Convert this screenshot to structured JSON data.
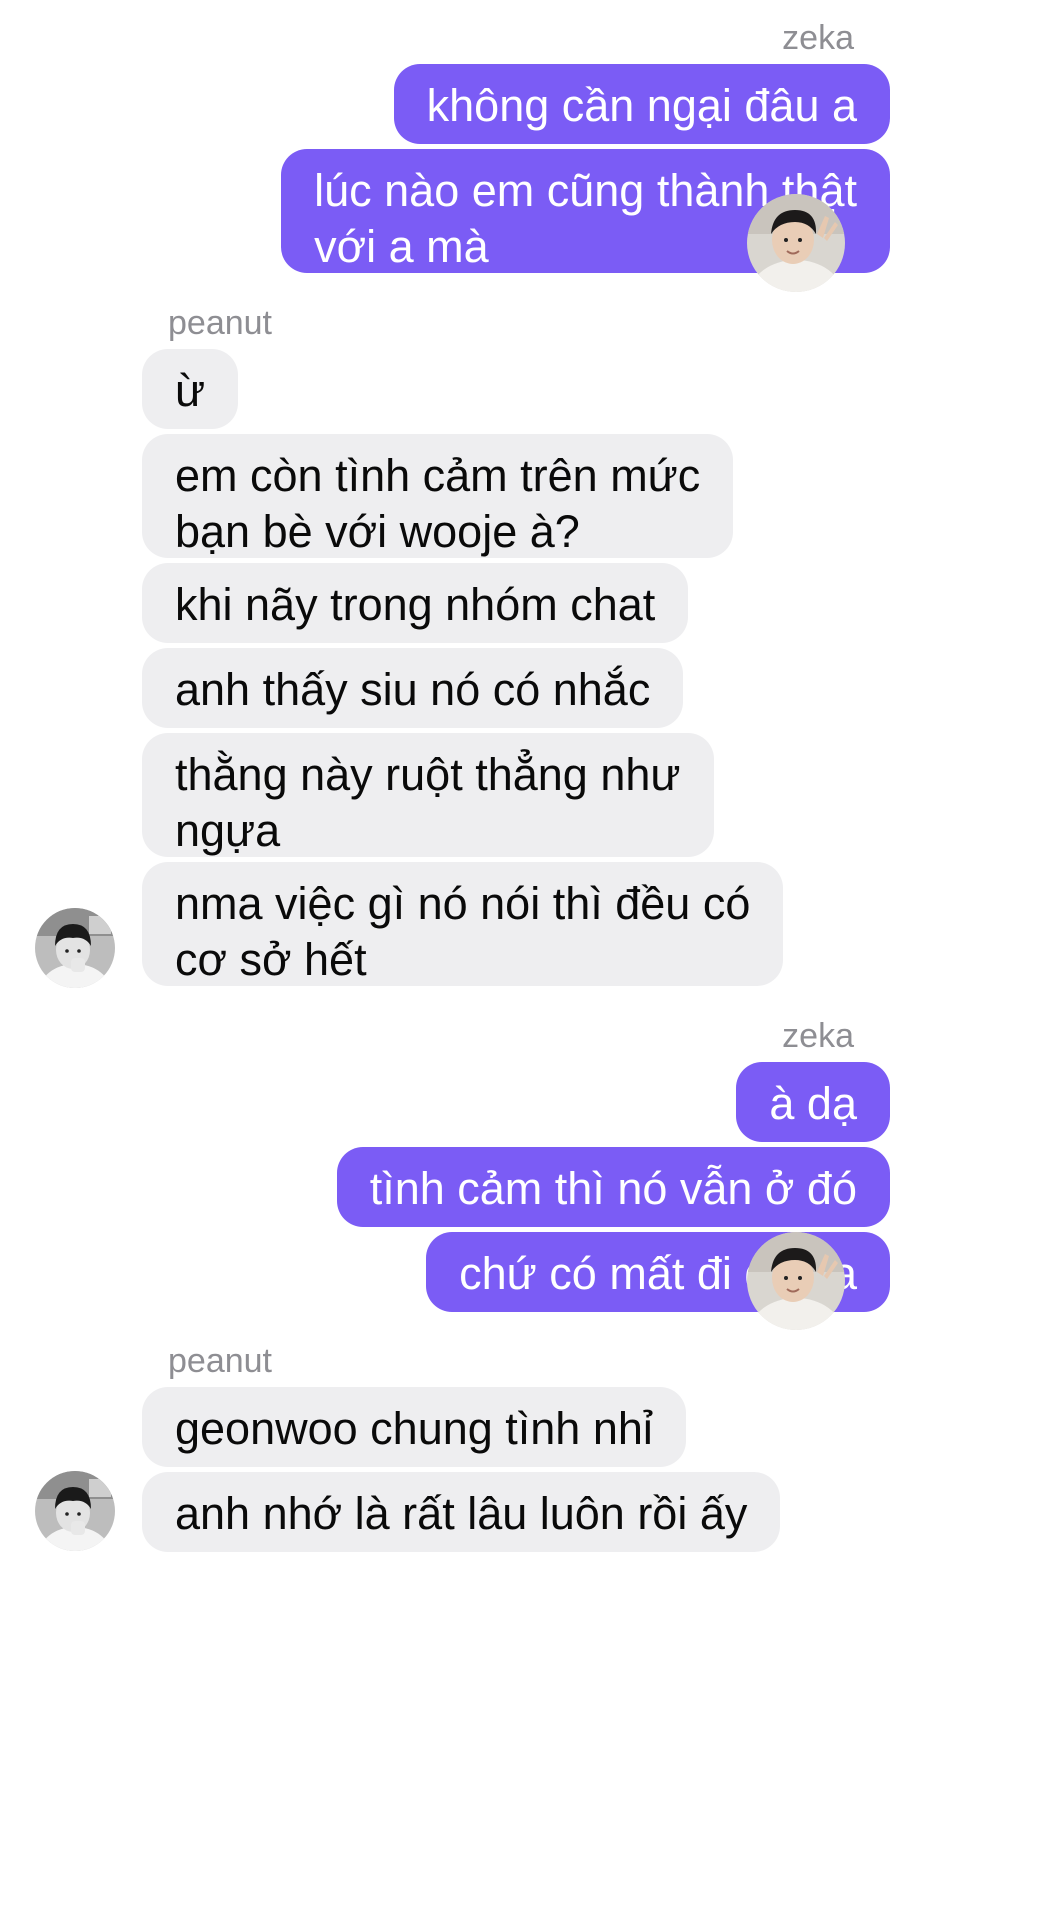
{
  "chat": {
    "groups": [
      {
        "sender": "zeka",
        "messages": [
          "không cần ngại đâu a",
          "lúc nào em cũng thành thật\nvới a mà"
        ]
      },
      {
        "sender": "peanut",
        "messages": [
          "ừ",
          "em còn tình cảm trên mức\nbạn bè với wooje à?",
          "khi nãy trong nhóm chat",
          "anh thấy siu nó có nhắc",
          "thằng này ruột thẳng như\nngựa",
          "nma việc gì nó nói thì đều có\ncơ sở hết"
        ]
      },
      {
        "sender": "zeka",
        "messages": [
          "à dạ",
          "tình cảm thì nó vẫn ở đó",
          "chứ có mất đi đâu a"
        ]
      },
      {
        "sender": "peanut",
        "messages": [
          "geonwoo chung tình nhỉ",
          "anh nhớ là rất lâu luôn rồi ấy"
        ]
      }
    ]
  },
  "colors": {
    "outgoing_bubble": "#7b5cf5",
    "incoming_bubble": "#eeeef0",
    "sender_name": "#8e8e93"
  }
}
